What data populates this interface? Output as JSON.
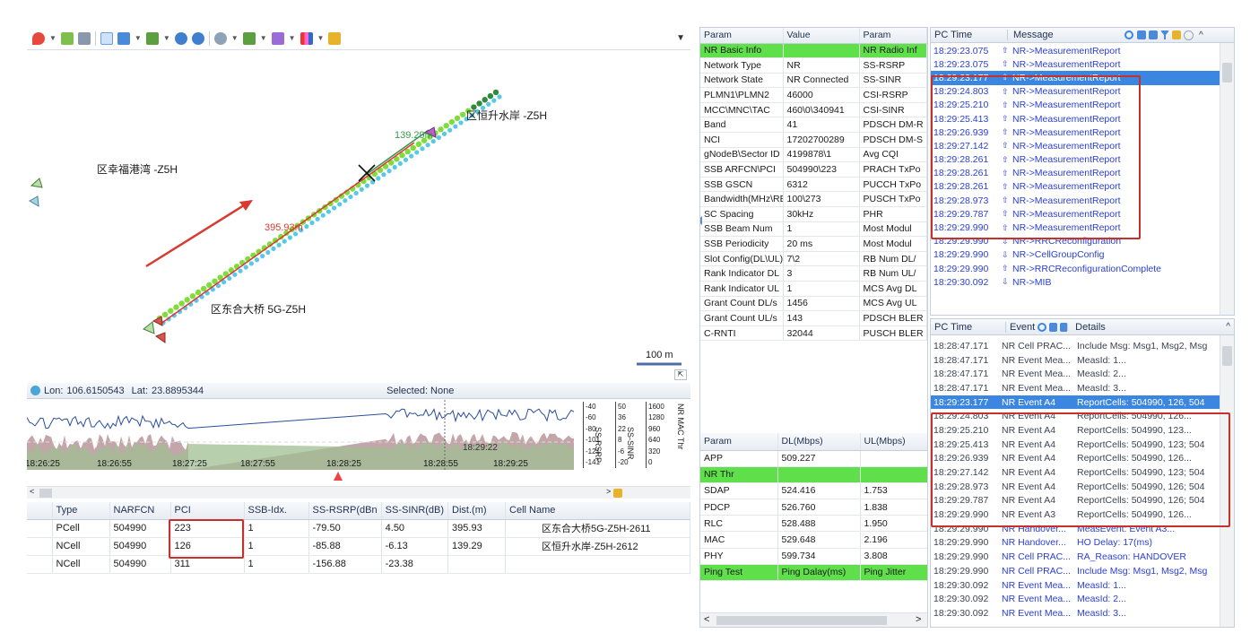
{
  "map": {
    "toolbar_dropdown": "▼",
    "labels": [
      "区幸福港湾 -Z5H",
      "区恒升水岸 -Z5H",
      "区东合大桥 5G-Z5H"
    ],
    "dist_green": "139.29m",
    "dist_red": "395.93m",
    "scale": "100 m",
    "status_lon_label": "Lon:",
    "status_lon": "106.6150543",
    "status_lat_label": "Lat:",
    "status_lat": "23.8895344",
    "status_selected": "Selected: None"
  },
  "timeline": {
    "times": [
      "18:26:25",
      "18:26:55",
      "18:27:25",
      "18:27:55",
      "18:28:25",
      "18:28:55",
      "18:29:25"
    ],
    "cursor_time": "18:29:22",
    "axis1": [
      "-40",
      "-60",
      "-80",
      "-101",
      "-121",
      "-141"
    ],
    "axis1_label": "SS-RSRP",
    "axis2": [
      "50",
      "36",
      "22",
      "8",
      "-6",
      "-20"
    ],
    "axis2_label": "SS-SINR",
    "axis3": [
      "1600",
      "1280",
      "960",
      "640",
      "320",
      "0"
    ],
    "axis3_label": "NR MAC Thr"
  },
  "cells": {
    "headers": [
      "Type",
      "NARFCN",
      "PCI",
      "SSB-Idx.",
      "SS-RSRP(dBn",
      "SS-SINR(dB)",
      "Dist.(m)",
      "Cell Name"
    ],
    "rows": [
      {
        "type": "PCell",
        "narfcn": "504990",
        "pci": "223",
        "ssb": "1",
        "rsrp": "-79.50",
        "sinr": "4.50",
        "dist": "395.93",
        "name": "区东合大桥5G-Z5H-2611"
      },
      {
        "type": "NCell",
        "narfcn": "504990",
        "pci": "126",
        "ssb": "1",
        "rsrp": "-85.88",
        "sinr": "-6.13",
        "dist": "139.29",
        "name": "区恒升水岸-Z5H-2612"
      },
      {
        "type": "NCell",
        "narfcn": "504990",
        "pci": "311",
        "ssb": "1",
        "rsrp": "-156.88",
        "sinr": "-23.38",
        "dist": "",
        "name": ""
      }
    ]
  },
  "params": {
    "headers": [
      "Param",
      "Value",
      "Param"
    ],
    "rows": [
      [
        "NR Basic Info",
        "",
        "NR Radio Inf"
      ],
      [
        "Network Type",
        "NR",
        "SS-RSRP"
      ],
      [
        "Network State",
        "NR Connected",
        "SS-SINR"
      ],
      [
        "PLMN1\\PLMN2",
        "46000",
        "CSI-RSRP"
      ],
      [
        "MCC\\MNC\\TAC",
        "460\\0\\340941",
        "CSI-SINR"
      ],
      [
        "Band",
        "41",
        "PDSCH DM-R"
      ],
      [
        "NCI",
        "17202700289",
        "PDSCH DM-S"
      ],
      [
        "gNodeB\\Sector ID",
        "4199878\\1",
        "Avg CQI"
      ],
      [
        "SSB ARFCN\\PCI",
        "504990\\223",
        "PRACH TxPo"
      ],
      [
        "SSB GSCN",
        "6312",
        "PUCCH TxPo"
      ],
      [
        "Bandwidth(MHz\\RB)",
        "100\\273",
        "PUSCH TxPo"
      ],
      [
        "SC Spacing",
        "30kHz",
        "PHR"
      ],
      [
        "SSB Beam Num",
        "1",
        "Most Modul"
      ],
      [
        "SSB Periodicity",
        "20 ms",
        "Most Modul"
      ],
      [
        "Slot Config(DL\\UL)",
        "7\\2",
        "RB Num DL/"
      ],
      [
        "Rank Indicator DL",
        "3",
        "RB Num UL/"
      ],
      [
        "Rank Indicator UL",
        "1",
        "MCS Avg DL"
      ],
      [
        "Grant Count DL/s",
        "1456",
        "MCS Avg UL"
      ],
      [
        "Grant Count UL/s",
        "143",
        "PDSCH BLER"
      ],
      [
        "C-RNTI",
        "32044",
        "PUSCH BLER"
      ]
    ]
  },
  "thr": {
    "headers": [
      "Param",
      "DL(Mbps)",
      "UL(Mbps)"
    ],
    "rows": [
      [
        "APP",
        "509.227",
        ""
      ],
      [
        "NR Thr",
        "",
        ""
      ],
      [
        "SDAP",
        "524.416",
        "1.753"
      ],
      [
        "PDCP",
        "526.760",
        "1.838"
      ],
      [
        "RLC",
        "528.488",
        "1.950"
      ],
      [
        "MAC",
        "529.648",
        "2.196"
      ],
      [
        "PHY",
        "599.734",
        "3.808"
      ],
      [
        "Ping Test",
        "Ping Dalay(ms)",
        "Ping Jitter"
      ]
    ]
  },
  "messages": {
    "headers": [
      "PC Time",
      "Message"
    ],
    "rows": [
      [
        "18:29:23.075",
        "up",
        "NR->MeasurementReport"
      ],
      [
        "18:29:23.075",
        "up",
        "NR->MeasurementReport"
      ],
      [
        "18:29:23.177",
        "up",
        "NR->MeasurementReport"
      ],
      [
        "18:29:24.803",
        "up",
        "NR->MeasurementReport"
      ],
      [
        "18:29:25.210",
        "up",
        "NR->MeasurementReport"
      ],
      [
        "18:29:25.413",
        "up",
        "NR->MeasurementReport"
      ],
      [
        "18:29:26.939",
        "up",
        "NR->MeasurementReport"
      ],
      [
        "18:29:27.142",
        "up",
        "NR->MeasurementReport"
      ],
      [
        "18:29:28.261",
        "up",
        "NR->MeasurementReport"
      ],
      [
        "18:29:28.261",
        "up",
        "NR->MeasurementReport"
      ],
      [
        "18:29:28.261",
        "up",
        "NR->MeasurementReport"
      ],
      [
        "18:29:28.973",
        "up",
        "NR->MeasurementReport"
      ],
      [
        "18:29:29.787",
        "up",
        "NR->MeasurementReport"
      ],
      [
        "18:29:29.990",
        "up",
        "NR->MeasurementReport"
      ],
      [
        "18:29:29.990",
        "down",
        "NR->RRCReconfiguration"
      ],
      [
        "18:29:29.990",
        "down",
        "NR->CellGroupConfig"
      ],
      [
        "18:29:29.990",
        "up",
        "NR->RRCReconfigurationComplete"
      ],
      [
        "18:29:30.092",
        "down",
        "NR->MIB"
      ]
    ]
  },
  "events": {
    "headers": [
      "PC Time",
      "Event",
      "Details"
    ],
    "rows": [
      [
        "18:28:47.171",
        "NR Cell PRAC...",
        "Include Msg: Msg1, Msg2, Msg"
      ],
      [
        "18:28:47.171",
        "NR Event Mea...",
        "MeasId: 1..."
      ],
      [
        "18:28:47.171",
        "NR Event Mea...",
        "MeasId: 2..."
      ],
      [
        "18:28:47.171",
        "NR Event Mea...",
        "MeasId: 3..."
      ],
      [
        "18:29:23.177",
        "NR Event A4",
        "ReportCells: 504990, 126, 504"
      ],
      [
        "18:29:24.803",
        "NR Event A4",
        "ReportCells: 504990, 126..."
      ],
      [
        "18:29:25.210",
        "NR Event A4",
        "ReportCells: 504990, 123..."
      ],
      [
        "18:29:25.413",
        "NR Event A4",
        "ReportCells: 504990, 123; 504"
      ],
      [
        "18:29:26.939",
        "NR Event A4",
        "ReportCells: 504990, 126..."
      ],
      [
        "18:29:27.142",
        "NR Event A4",
        "ReportCells: 504990, 123; 504"
      ],
      [
        "18:29:28.973",
        "NR Event A4",
        "ReportCells: 504990, 126; 504"
      ],
      [
        "18:29:29.787",
        "NR Event A4",
        "ReportCells: 504990, 126; 504"
      ],
      [
        "18:29:29.990",
        "NR Event A3",
        "ReportCells: 504990, 126..."
      ],
      [
        "18:29:29.990",
        "NR Handover...",
        "MeasEvent: Event A3..."
      ],
      [
        "18:29:29.990",
        "NR Handover...",
        "HO Delay: 17(ms)"
      ],
      [
        "18:29:29.990",
        "NR Cell PRAC...",
        "RA_Reason: HANDOVER"
      ],
      [
        "18:29:29.990",
        "NR Cell PRAC...",
        "Include Msg: Msg1, Msg2, Msg"
      ],
      [
        "18:29:30.092",
        "NR Event Mea...",
        "MeasId: 1..."
      ],
      [
        "18:29:30.092",
        "NR Event Mea...",
        "MeasId: 2..."
      ],
      [
        "18:29:30.092",
        "NR Event Mea...",
        "MeasId: 3..."
      ]
    ]
  },
  "colors": {
    "accent": "#3a86e0",
    "highlight": "#c8302c",
    "green_row": "#5fe04a",
    "route": "#7fdc3a"
  }
}
